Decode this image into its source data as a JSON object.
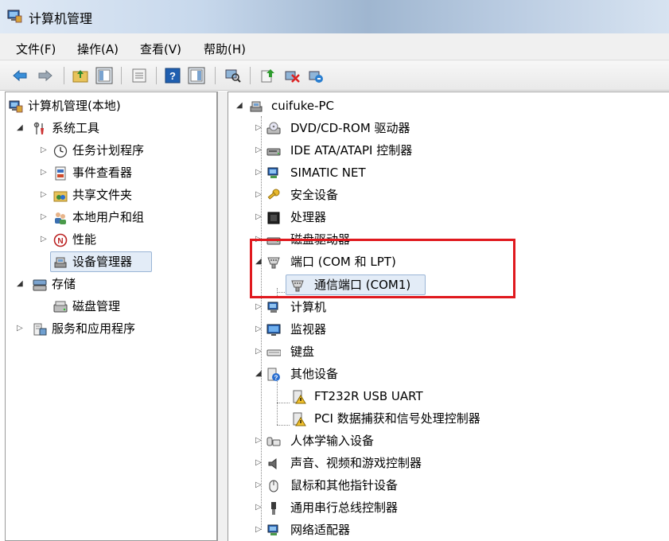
{
  "window": {
    "title": "计算机管理"
  },
  "menu": [
    "文件(F)",
    "操作(A)",
    "查看(V)",
    "帮助(H)"
  ],
  "toolbar": {
    "icons": [
      "back-arrow-icon",
      "forward-arrow-icon",
      "up-folder-icon",
      "show-hide-tree-icon",
      "properties-icon",
      "help-icon",
      "show-hide-action-icon",
      "scan-hardware-icon",
      "update-driver-icon",
      "disable-device-icon",
      "uninstall-device-icon"
    ]
  },
  "left_tree": {
    "root": "计算机管理(本地)",
    "system_tools": "系统工具",
    "task_scheduler": "任务计划程序",
    "event_viewer": "事件查看器",
    "shared_folders": "共享文件夹",
    "local_users": "本地用户和组",
    "performance": "性能",
    "device_manager": "设备管理器",
    "storage": "存储",
    "disk_management": "磁盘管理",
    "services_apps": "服务和应用程序"
  },
  "right_tree": {
    "computer": "cuifuke-PC",
    "dvd": "DVD/CD-ROM 驱动器",
    "ide": "IDE ATA/ATAPI 控制器",
    "simatic": "SIMATIC NET",
    "security": "安全设备",
    "processor": "处理器",
    "disk_drives": "磁盘驱动器",
    "ports": "端口 (COM 和 LPT)",
    "com1": "通信端口 (COM1)",
    "computer_node": "计算机",
    "monitors": "监视器",
    "keyboards": "键盘",
    "other_devices": "其他设备",
    "ft232r": "FT232R USB UART",
    "pci": "PCI 数据捕获和信号处理控制器",
    "hid": "人体学输入设备",
    "sound": "声音、视频和游戏控制器",
    "mice": "鼠标和其他指针设备",
    "usb": "通用串行总线控制器",
    "network": "网络适配器"
  },
  "colors": {
    "highlight_box": "#e0191e",
    "selection": "#e3ecf7"
  }
}
